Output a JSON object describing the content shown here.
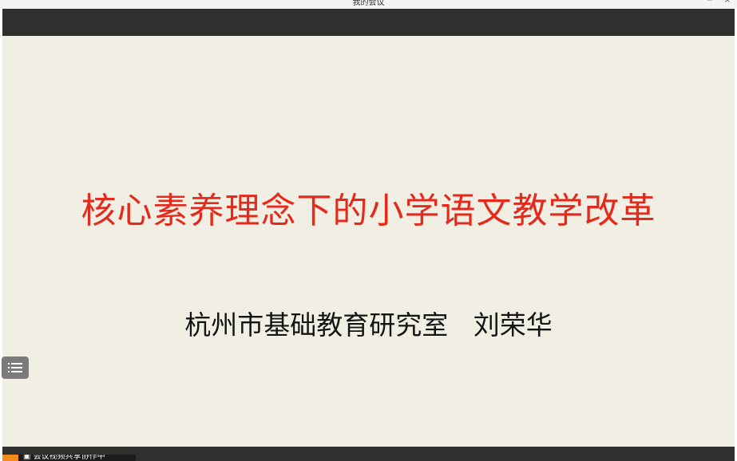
{
  "window": {
    "title": "我的会议",
    "minimize_icon": "minimize-icon",
    "close_icon": "close-icon"
  },
  "slide": {
    "title": "核心素养理念下的小学语文教学改革",
    "subtitle": "杭州市基础教育研究室   刘荣华",
    "title_color": "#e42a1d",
    "subtitle_color": "#141414",
    "background_color": "#f1efe3"
  },
  "controls": {
    "list_button_icon": "list-icon"
  },
  "bottom_bar": {
    "badge_icon": "app-icon",
    "badge_text": "▣ 会议视频共享协作中"
  }
}
